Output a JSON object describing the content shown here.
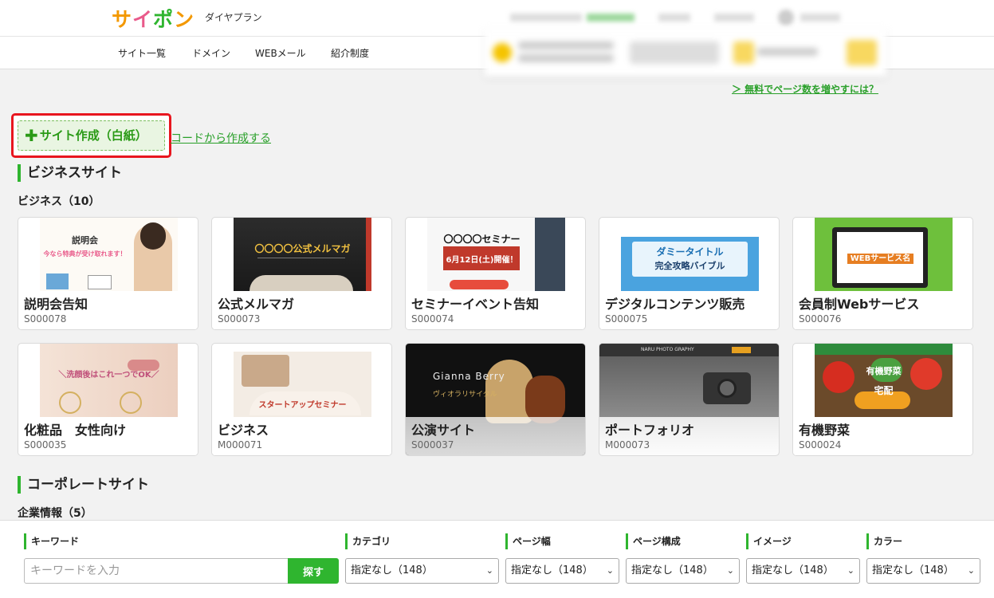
{
  "header": {
    "logo": [
      "サ",
      "イ",
      "ポ",
      "ン"
    ],
    "plan": "ダイヤプラン",
    "more_link": "＞ 無料でページ数を増やすには？"
  },
  "nav": [
    "サイト一覧",
    "ドメイン",
    "WEBメール",
    "紹介制度"
  ],
  "actions": {
    "create_blank": "サイト作成（白紙）",
    "from_code": "コードから作成する"
  },
  "sections": [
    {
      "title": "ビジネスサイト",
      "subtitle": "ビジネス（10）"
    },
    {
      "title": "コーポレートサイト",
      "subtitle": "企業情報（5）"
    }
  ],
  "templates": [
    {
      "name": "説明会告知",
      "code": "S000078",
      "thumb": "説明会",
      "thumb_sub": "今なら特典が受け取れます！"
    },
    {
      "name": "公式メルマガ",
      "code": "S000073",
      "thumb": "〇〇〇〇公式メルマガ",
      "thumb_sub": ""
    },
    {
      "name": "セミナーイベント告知",
      "code": "S000074",
      "thumb": "〇〇〇〇セミナー",
      "thumb_sub": "6月12日(土)開催！"
    },
    {
      "name": "デジタルコンテンツ販売",
      "code": "S000075",
      "thumb": "ダミータイトル",
      "thumb_sub": "完全攻略バイブル"
    },
    {
      "name": "会員制Webサービス",
      "code": "S000076",
      "thumb": "WEBサービス名",
      "thumb_sub": ""
    },
    {
      "name": "化粧品　女性向け",
      "code": "S000035",
      "thumb": "＼洗顔後はこれ一つでOK／",
      "thumb_sub": ""
    },
    {
      "name": "ビジネス",
      "code": "M000071",
      "thumb": "スタートアップセミナー",
      "thumb_sub": ""
    },
    {
      "name": "公演サイト",
      "code": "S000037",
      "thumb": "Gianna Berry",
      "thumb_sub": "ヴィオラリサイタル"
    },
    {
      "name": "ポートフォリオ",
      "code": "M000073",
      "thumb": "NARU PHOTO GRAPHY",
      "thumb_sub": ""
    },
    {
      "name": "有機野菜",
      "code": "S000024",
      "thumb": "有機野菜",
      "thumb_sub": "宅配"
    }
  ],
  "filters": {
    "keyword_label": "キーワード",
    "keyword_placeholder": "キーワードを入力",
    "search_label": "探す",
    "selects": [
      {
        "label": "カテゴリ",
        "value": "指定なし（148）"
      },
      {
        "label": "ページ幅",
        "value": "指定なし（148）"
      },
      {
        "label": "ページ構成",
        "value": "指定なし（148）"
      },
      {
        "label": "イメージ",
        "value": "指定なし（148）"
      },
      {
        "label": "カラー",
        "value": "指定なし（148）"
      }
    ]
  },
  "colors": {
    "accent": "#2fb52f",
    "highlight": "#e8161f"
  }
}
